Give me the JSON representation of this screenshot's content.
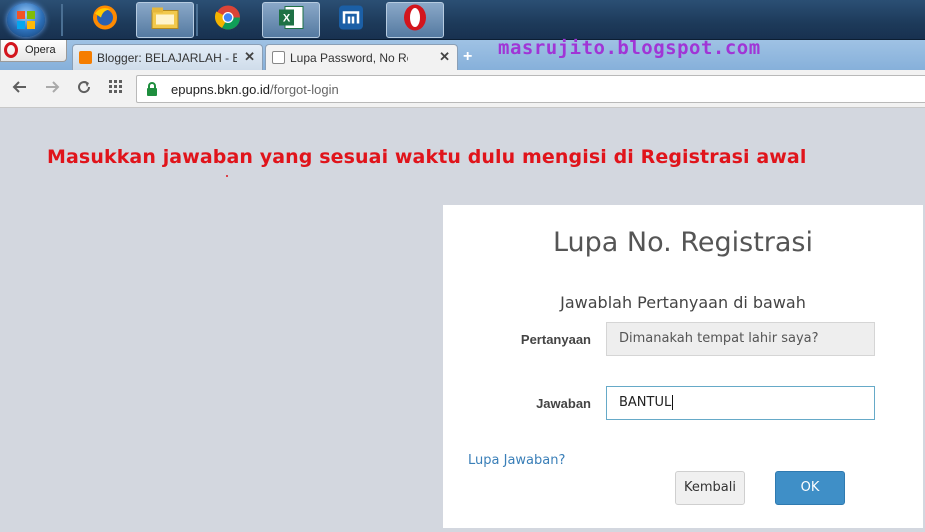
{
  "taskbar": {
    "icons": [
      "windows-start-orb",
      "firefox-icon",
      "file-explorer-icon",
      "chrome-icon",
      "excel-icon",
      "maxthon-icon",
      "opera-icon"
    ]
  },
  "browser": {
    "opera_menu_label": "Opera",
    "tabs": [
      {
        "label": "Blogger: BELAJARLAH - Bu",
        "favicon_color": "#f57d00",
        "active": false
      },
      {
        "label": "Lupa Password, No Registr",
        "favicon_color": "#888888",
        "active": true
      }
    ],
    "close_glyph": "✕",
    "new_tab_glyph": "+",
    "url_host": "epupns.bkn.go.id",
    "url_path": "/forgot-login"
  },
  "watermark": "masrujito.blogspot.com",
  "annotation": "Masukkan jawaban yang sesuai waktu dulu mengisi di Registrasi awal",
  "form": {
    "title": "Lupa No. Registrasi",
    "subtitle": "Jawablah Pertanyaan di bawah",
    "question_label": "Pertanyaan",
    "question_value": "Dimanakah tempat lahir saya?",
    "answer_label": "Jawaban",
    "answer_value": "BANTUL",
    "forgot_answer_link": "Lupa Jawaban?",
    "back_button": "Kembali",
    "ok_button": "OK"
  },
  "colors": {
    "accent": "#3f8fc7",
    "annotation": "#e0141b",
    "watermark": "#a035d6",
    "link": "#3a7fb8"
  }
}
